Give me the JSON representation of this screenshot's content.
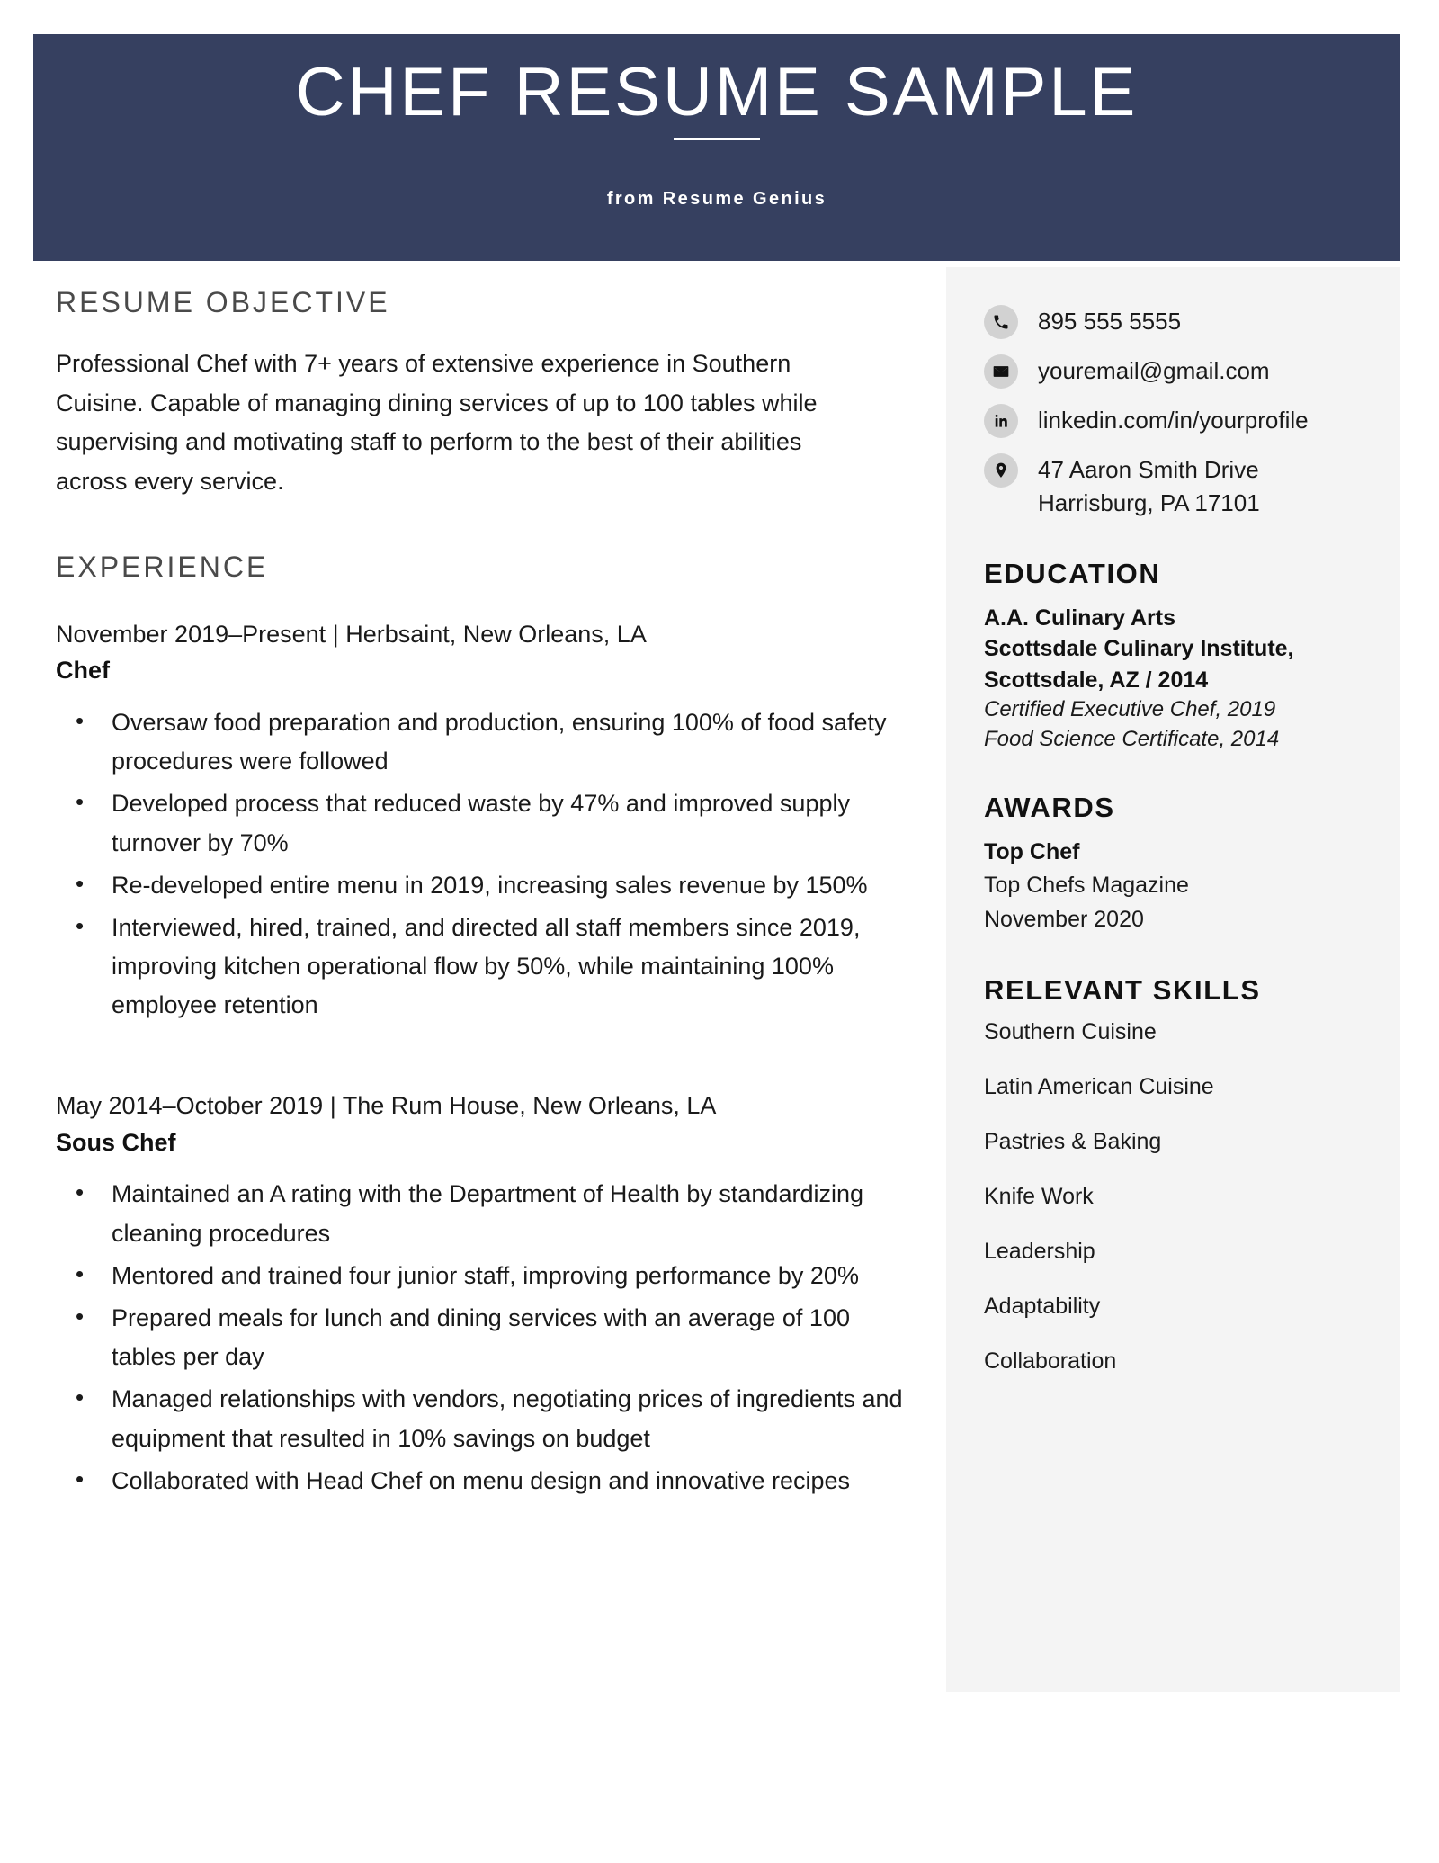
{
  "header": {
    "title": "CHEF RESUME SAMPLE",
    "subtitle": "from Resume Genius",
    "background_color": "#364060",
    "text_color": "#ffffff"
  },
  "main": {
    "objective": {
      "heading": "RESUME OBJECTIVE",
      "text": "Professional Chef with 7+ years of extensive experience in Southern Cuisine. Capable of managing dining services of up to 100 tables while supervising and motivating staff to perform to the best of their abilities across every service."
    },
    "experience": {
      "heading": "EXPERIENCE",
      "jobs": [
        {
          "meta": "November 2019–Present | Herbsaint, New Orleans, LA",
          "title": "Chef",
          "bullets": [
            "Oversaw food preparation and production, ensuring 100% of food safety procedures were followed",
            "Developed process that reduced waste by 47% and improved supply turnover by 70%",
            "Re-developed entire menu in 2019, increasing sales revenue by 150%",
            "Interviewed, hired, trained, and directed all staff members since 2019, improving kitchen operational flow by 50%, while maintaining 100% employee retention"
          ]
        },
        {
          "meta": "May 2014–October 2019 | The Rum House, New Orleans, LA",
          "title": "Sous Chef",
          "bullets": [
            "Maintained an A rating with the Department of Health by standardizing cleaning procedures",
            "Mentored and trained four junior staff, improving performance by 20%",
            "Prepared meals for lunch and dining services with an average of 100 tables per day",
            "Managed relationships with vendors, negotiating prices of ingredients and equipment that resulted in 10% savings on budget",
            "Collaborated with Head Chef on menu design and innovative recipes"
          ]
        }
      ]
    }
  },
  "sidebar": {
    "background_color": "#f4f4f4",
    "contact": [
      {
        "icon": "phone-icon",
        "value": "895 555 5555",
        "value_line2": ""
      },
      {
        "icon": "email-icon",
        "value": "youremail@gmail.com",
        "value_line2": ""
      },
      {
        "icon": "linkedin-icon",
        "value": "linkedin.com/in/yourprofile",
        "value_line2": ""
      },
      {
        "icon": "location-pin-icon",
        "value": "47 Aaron Smith Drive",
        "value_line2": "Harrisburg, PA 17101"
      }
    ],
    "education": {
      "heading": "EDUCATION",
      "degree": "A.A. Culinary Arts",
      "school": "Scottsdale Culinary Institute,",
      "school_location_year": "Scottsdale, AZ / 2014",
      "certifications": [
        "Certified Executive Chef, 2019",
        "Food Science Certificate, 2014"
      ]
    },
    "awards": {
      "heading": "AWARDS",
      "name": "Top Chef",
      "issuer": "Top Chefs Magazine",
      "date": "November 2020"
    },
    "skills": {
      "heading": "RELEVANT SKILLS",
      "items": [
        "Southern Cuisine",
        "Latin American Cuisine",
        "Pastries & Baking",
        "Knife Work",
        "Leadership",
        "Adaptability",
        "Collaboration"
      ]
    }
  }
}
